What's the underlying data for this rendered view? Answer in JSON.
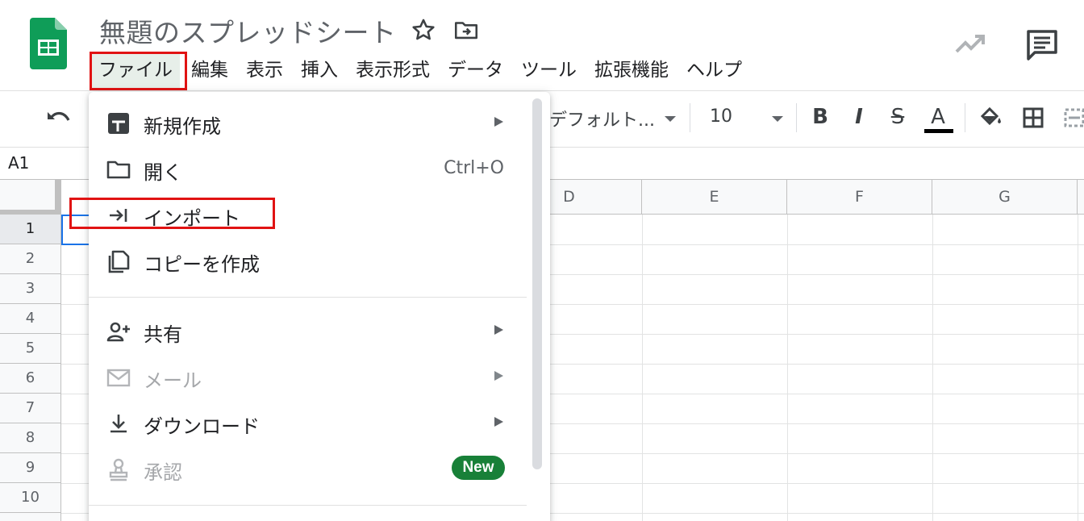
{
  "app": {
    "doc_title": "無題のスプレッドシート",
    "logo_icon": "sheets-logo-icon",
    "brand_color": "#0f9d58"
  },
  "menubar": {
    "items": [
      {
        "label": "ファイル",
        "active": true
      },
      {
        "label": "編集"
      },
      {
        "label": "表示"
      },
      {
        "label": "挿入"
      },
      {
        "label": "表示形式"
      },
      {
        "label": "データ"
      },
      {
        "label": "ツール"
      },
      {
        "label": "拡張機能"
      },
      {
        "label": "ヘルプ"
      }
    ],
    "highlight_color": "#e11313"
  },
  "toolbar": {
    "font": "デフォルト...",
    "font_size": "10",
    "bold": "B",
    "italic": "I",
    "strike": "S",
    "text_color": "A"
  },
  "name_box": "A1",
  "grid": {
    "columns": [
      "D",
      "E",
      "F",
      "G"
    ],
    "rows": [
      "1",
      "2",
      "3",
      "4",
      "5",
      "6",
      "7",
      "8",
      "9",
      "10"
    ]
  },
  "file_menu": {
    "items": [
      {
        "label": "新規作成",
        "icon": "new-sheet-icon",
        "submenu": true
      },
      {
        "label": "開く",
        "icon": "folder-icon",
        "shortcut": "Ctrl+O"
      },
      {
        "label": "インポート",
        "icon": "import-icon",
        "highlighted": true
      },
      {
        "label": "コピーを作成",
        "icon": "copy-icon"
      },
      {
        "label": "共有",
        "icon": "share-person-icon",
        "submenu": true
      },
      {
        "label": "メール",
        "icon": "mail-icon",
        "submenu": true,
        "disabled": true
      },
      {
        "label": "ダウンロード",
        "icon": "download-icon",
        "submenu": true
      },
      {
        "label": "承認",
        "icon": "approval-stamp-icon",
        "disabled": true,
        "badge": "New",
        "badge_color": "#188038"
      }
    ]
  }
}
